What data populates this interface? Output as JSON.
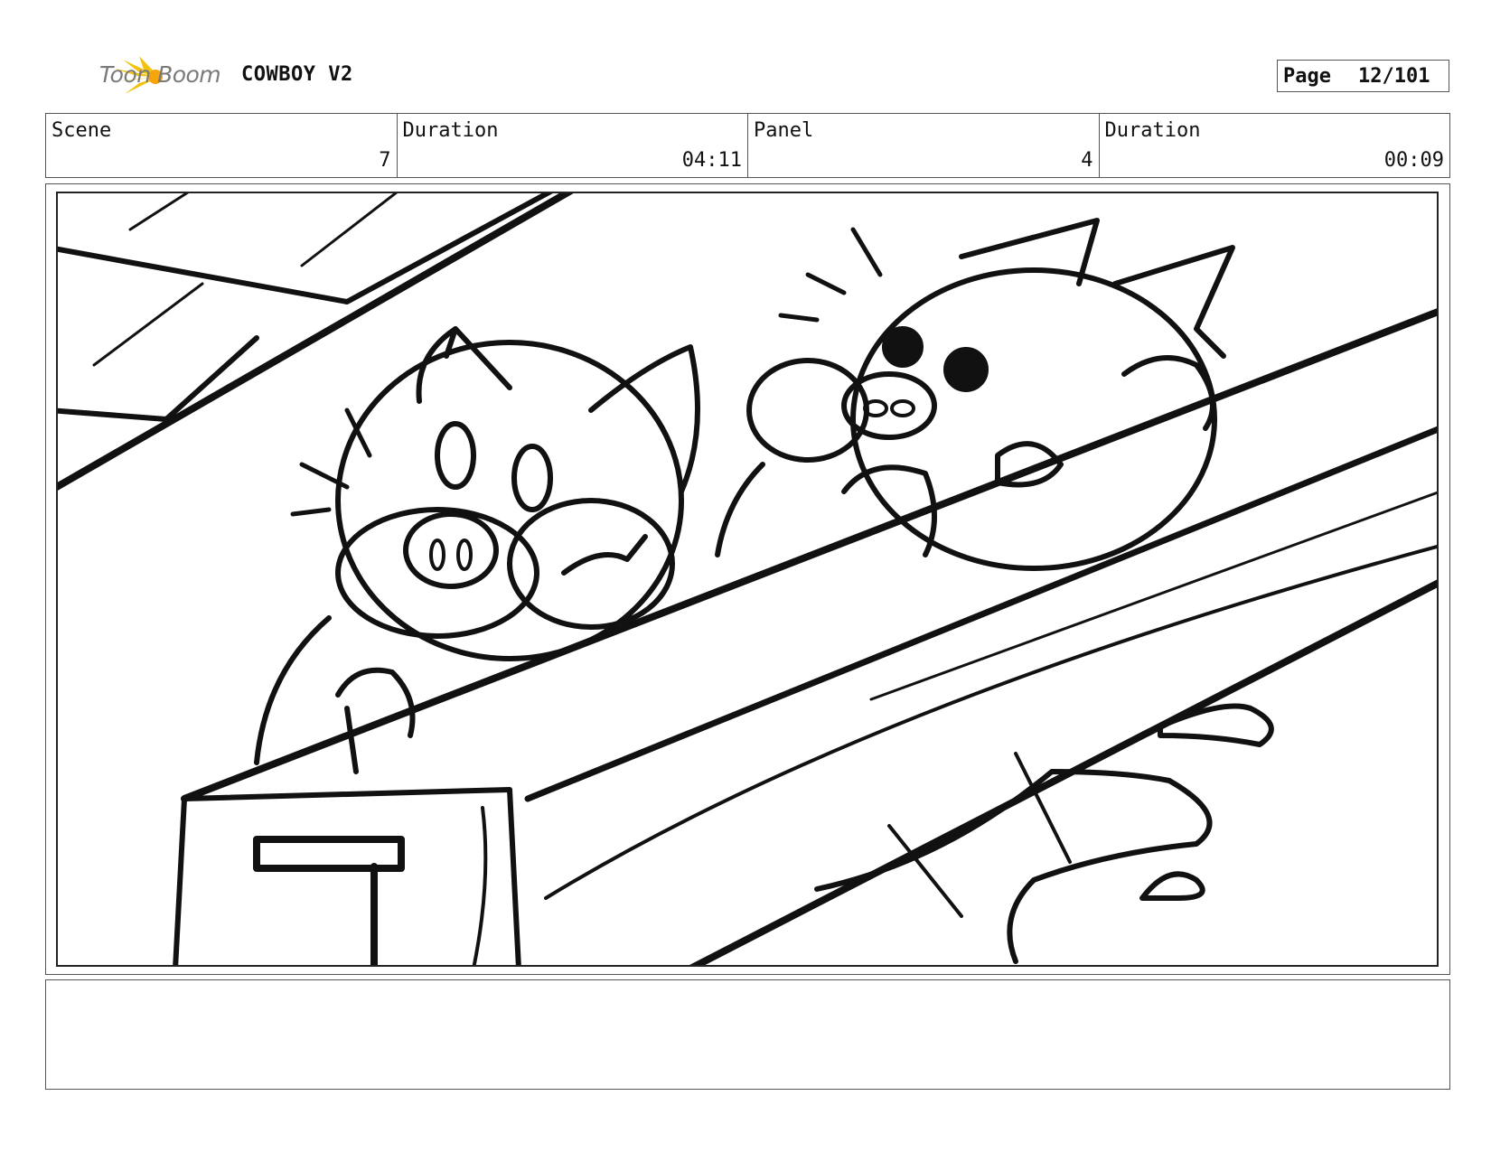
{
  "header": {
    "logo_text": "Toon Boom",
    "project_title": "COWBOY V2",
    "page_label": "Page",
    "page_value": "12/101"
  },
  "info": {
    "scene_label": "Scene",
    "scene_value": "7",
    "scene_duration_label": "Duration",
    "scene_duration_value": "04:11",
    "panel_label": "Panel",
    "panel_value": "4",
    "panel_duration_label": "Duration",
    "panel_duration_value": "00:09"
  },
  "panel": {
    "description": "Two cartoon pigs peering over a wooden ledge with worried expressions",
    "notes": ""
  },
  "colors": {
    "logo_accent": "#f2c20f",
    "ink": "#111111",
    "frame": "#555555"
  }
}
